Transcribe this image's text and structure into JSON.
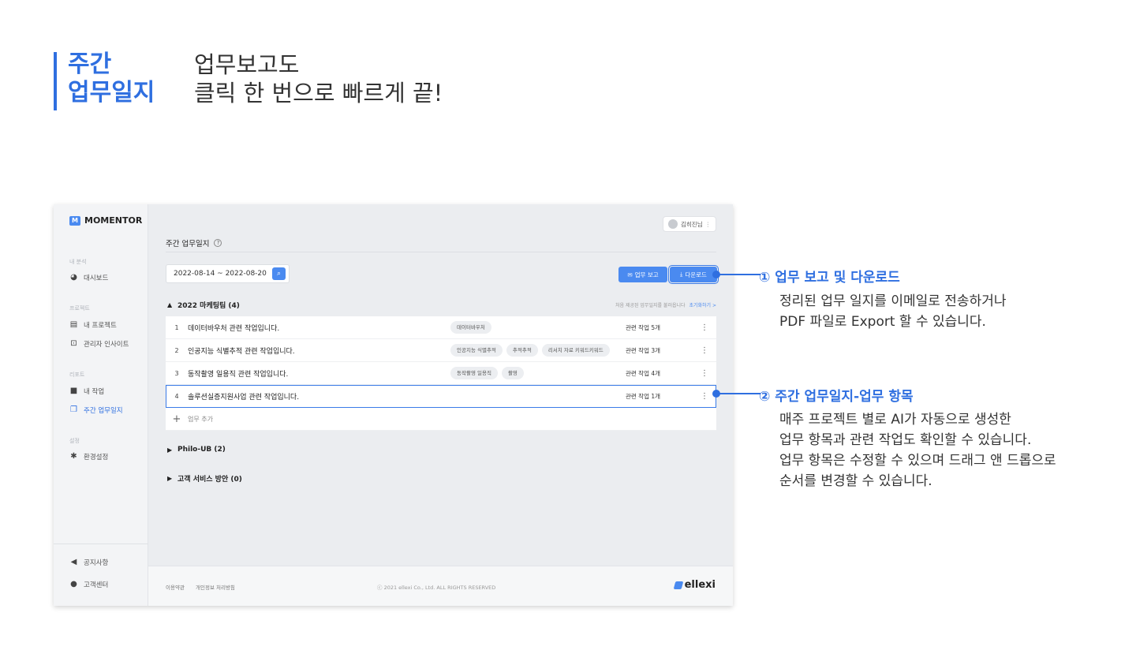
{
  "headline": {
    "left_line1": "주간",
    "left_line2": "업무일지",
    "right_line1": "업무보고도",
    "right_line2": "클릭 한 번으로 빠르게 끝!"
  },
  "app": {
    "logo": "MOMENTOR",
    "sidebar": {
      "section_analysis": "내 분석",
      "dashboard": "대시보드",
      "section_project": "프로젝트",
      "my_project": "내 프로젝트",
      "admin_insight": "관리자 인사이트",
      "section_report": "리포트",
      "my_work": "내 작업",
      "weekly_log": "주간 업무일지",
      "section_settings": "설정",
      "settings": "환경설정",
      "notice": "공지사항",
      "support": "고객센터"
    },
    "user": "김히진님",
    "page_title": "주간 업무일지",
    "date_range": "2022-08-14 ~ 2022-08-20",
    "report_button": "업무 보고",
    "download_button": "다운로드",
    "group_note": "처음 제공된 업무일지를 불러옵니다",
    "group_note_link": "초기화하기 >",
    "groups": [
      {
        "label": "2022 마케팅팀 (4)",
        "expanded": true
      },
      {
        "label": "Philo-UB (2)",
        "expanded": false
      },
      {
        "label": "고객 서비스 방안 (0)",
        "expanded": false
      }
    ],
    "rows": [
      {
        "num": "1",
        "title": "데이터바우처 관련 작업입니다.",
        "tags": [
          "데이터바우처"
        ],
        "related": "관련 작업 5개"
      },
      {
        "num": "2",
        "title": "인공지능 식별추적 관련 작업입니다.",
        "tags": [
          "인공지능 식별추적",
          "추적추적",
          "리서치 자료 키워드키워드"
        ],
        "related": "관련 작업 3개"
      },
      {
        "num": "3",
        "title": "동작촬영 일용직 관련 작업입니다.",
        "tags": [
          "동작촬영 일용직",
          "촬영"
        ],
        "related": "관련 작업 4개"
      },
      {
        "num": "4",
        "title": "솔루션실증지원사업 관련 작업입니다.",
        "tags": [],
        "related": "관련 작업 1개"
      }
    ],
    "add_row": "업무 추가",
    "footer": {
      "terms": "이용약관",
      "privacy": "개인정보 처리방침",
      "copyright": "ⓒ 2021 ellexi Co., Ltd. ALL RIGHTS RESERVED",
      "brand": "ellexi"
    }
  },
  "callouts": [
    {
      "title": "① 업무 보고 및 다운로드",
      "body": [
        "정리된 업무 일지를 이메일로 전송하거나",
        "PDF 파일로 Export 할 수 있습니다."
      ]
    },
    {
      "title": "② 주간 업무일지-업무 항목",
      "body": [
        "매주 프로젝트 별로 AI가 자동으로 생성한",
        "업무 항목과 관련 작업도 확인할 수 있습니다.",
        "업무 항목은 수정할 수 있으며 드래그 앤 드롭으로",
        "순서를 변경할 수 있습니다."
      ]
    }
  ],
  "colors": {
    "accent": "#2f6fe0",
    "button": "#4a8af0"
  }
}
